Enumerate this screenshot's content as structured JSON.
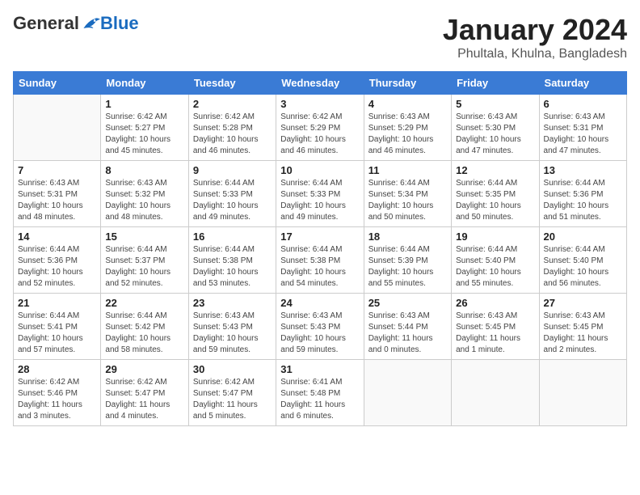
{
  "header": {
    "logo_general": "General",
    "logo_blue": "Blue",
    "month_title": "January 2024",
    "location": "Phultala, Khulna, Bangladesh"
  },
  "weekdays": [
    "Sunday",
    "Monday",
    "Tuesday",
    "Wednesday",
    "Thursday",
    "Friday",
    "Saturday"
  ],
  "weeks": [
    [
      {
        "day": "",
        "info": ""
      },
      {
        "day": "1",
        "info": "Sunrise: 6:42 AM\nSunset: 5:27 PM\nDaylight: 10 hours\nand 45 minutes."
      },
      {
        "day": "2",
        "info": "Sunrise: 6:42 AM\nSunset: 5:28 PM\nDaylight: 10 hours\nand 46 minutes."
      },
      {
        "day": "3",
        "info": "Sunrise: 6:42 AM\nSunset: 5:29 PM\nDaylight: 10 hours\nand 46 minutes."
      },
      {
        "day": "4",
        "info": "Sunrise: 6:43 AM\nSunset: 5:29 PM\nDaylight: 10 hours\nand 46 minutes."
      },
      {
        "day": "5",
        "info": "Sunrise: 6:43 AM\nSunset: 5:30 PM\nDaylight: 10 hours\nand 47 minutes."
      },
      {
        "day": "6",
        "info": "Sunrise: 6:43 AM\nSunset: 5:31 PM\nDaylight: 10 hours\nand 47 minutes."
      }
    ],
    [
      {
        "day": "7",
        "info": "Sunrise: 6:43 AM\nSunset: 5:31 PM\nDaylight: 10 hours\nand 48 minutes."
      },
      {
        "day": "8",
        "info": "Sunrise: 6:43 AM\nSunset: 5:32 PM\nDaylight: 10 hours\nand 48 minutes."
      },
      {
        "day": "9",
        "info": "Sunrise: 6:44 AM\nSunset: 5:33 PM\nDaylight: 10 hours\nand 49 minutes."
      },
      {
        "day": "10",
        "info": "Sunrise: 6:44 AM\nSunset: 5:33 PM\nDaylight: 10 hours\nand 49 minutes."
      },
      {
        "day": "11",
        "info": "Sunrise: 6:44 AM\nSunset: 5:34 PM\nDaylight: 10 hours\nand 50 minutes."
      },
      {
        "day": "12",
        "info": "Sunrise: 6:44 AM\nSunset: 5:35 PM\nDaylight: 10 hours\nand 50 minutes."
      },
      {
        "day": "13",
        "info": "Sunrise: 6:44 AM\nSunset: 5:36 PM\nDaylight: 10 hours\nand 51 minutes."
      }
    ],
    [
      {
        "day": "14",
        "info": "Sunrise: 6:44 AM\nSunset: 5:36 PM\nDaylight: 10 hours\nand 52 minutes."
      },
      {
        "day": "15",
        "info": "Sunrise: 6:44 AM\nSunset: 5:37 PM\nDaylight: 10 hours\nand 52 minutes."
      },
      {
        "day": "16",
        "info": "Sunrise: 6:44 AM\nSunset: 5:38 PM\nDaylight: 10 hours\nand 53 minutes."
      },
      {
        "day": "17",
        "info": "Sunrise: 6:44 AM\nSunset: 5:38 PM\nDaylight: 10 hours\nand 54 minutes."
      },
      {
        "day": "18",
        "info": "Sunrise: 6:44 AM\nSunset: 5:39 PM\nDaylight: 10 hours\nand 55 minutes."
      },
      {
        "day": "19",
        "info": "Sunrise: 6:44 AM\nSunset: 5:40 PM\nDaylight: 10 hours\nand 55 minutes."
      },
      {
        "day": "20",
        "info": "Sunrise: 6:44 AM\nSunset: 5:40 PM\nDaylight: 10 hours\nand 56 minutes."
      }
    ],
    [
      {
        "day": "21",
        "info": "Sunrise: 6:44 AM\nSunset: 5:41 PM\nDaylight: 10 hours\nand 57 minutes."
      },
      {
        "day": "22",
        "info": "Sunrise: 6:44 AM\nSunset: 5:42 PM\nDaylight: 10 hours\nand 58 minutes."
      },
      {
        "day": "23",
        "info": "Sunrise: 6:43 AM\nSunset: 5:43 PM\nDaylight: 10 hours\nand 59 minutes."
      },
      {
        "day": "24",
        "info": "Sunrise: 6:43 AM\nSunset: 5:43 PM\nDaylight: 10 hours\nand 59 minutes."
      },
      {
        "day": "25",
        "info": "Sunrise: 6:43 AM\nSunset: 5:44 PM\nDaylight: 11 hours\nand 0 minutes."
      },
      {
        "day": "26",
        "info": "Sunrise: 6:43 AM\nSunset: 5:45 PM\nDaylight: 11 hours\nand 1 minute."
      },
      {
        "day": "27",
        "info": "Sunrise: 6:43 AM\nSunset: 5:45 PM\nDaylight: 11 hours\nand 2 minutes."
      }
    ],
    [
      {
        "day": "28",
        "info": "Sunrise: 6:42 AM\nSunset: 5:46 PM\nDaylight: 11 hours\nand 3 minutes."
      },
      {
        "day": "29",
        "info": "Sunrise: 6:42 AM\nSunset: 5:47 PM\nDaylight: 11 hours\nand 4 minutes."
      },
      {
        "day": "30",
        "info": "Sunrise: 6:42 AM\nSunset: 5:47 PM\nDaylight: 11 hours\nand 5 minutes."
      },
      {
        "day": "31",
        "info": "Sunrise: 6:41 AM\nSunset: 5:48 PM\nDaylight: 11 hours\nand 6 minutes."
      },
      {
        "day": "",
        "info": ""
      },
      {
        "day": "",
        "info": ""
      },
      {
        "day": "",
        "info": ""
      }
    ]
  ]
}
